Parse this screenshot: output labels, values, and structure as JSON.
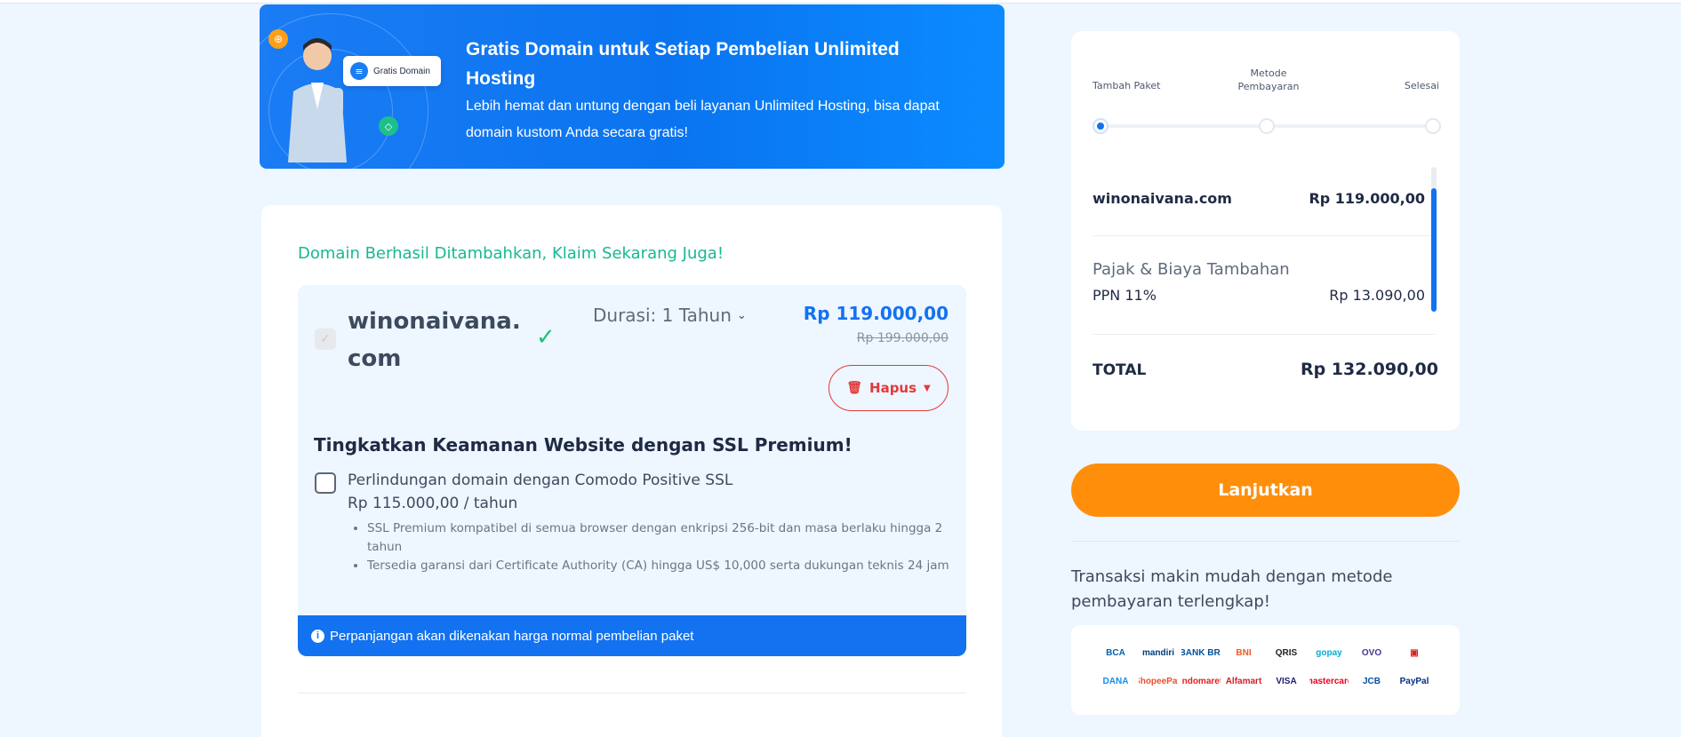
{
  "banner": {
    "badge_text": "Gratis Domain",
    "title": "Gratis Domain untuk Setiap Pembelian Unlimited Hosting",
    "subtitle": "Lebih hemat dan untung dengan beli layanan Unlimited Hosting, bisa dapat domain kustom Anda secara gratis!"
  },
  "main": {
    "success_message": "Domain Berhasil Ditambahkan, Klaim Sekarang Juga!",
    "domain": {
      "name": "winonaivana.com",
      "duration": "Durasi: 1 Tahun",
      "price": "Rp 119.000,00",
      "old_price": "Rp 199.000,00",
      "remove_label": "Hapus"
    },
    "ssl": {
      "title": "Tingkatkan Keamanan Website dengan SSL Premium!",
      "option_label": "Perlindungan domain dengan Comodo Positive SSL",
      "option_price": "Rp 115.000,00 / tahun",
      "features": [
        "SSL Premium kompatibel di semua browser dengan enkripsi 256-bit dan masa berlaku hingga 2 tahun",
        "Tersedia garansi dari Certificate Authority (CA) hingga US$ 10,000 serta dukungan teknis 24 jam"
      ]
    },
    "renewal_notice": "Perpanjangan akan dikenakan harga normal pembelian paket"
  },
  "summary": {
    "steps": [
      "Tambah Paket",
      "Metode Pembayaran",
      "Selesai"
    ],
    "active_step": 1,
    "items": [
      {
        "name": "winonaivana.com",
        "price": "Rp 119.000,00"
      }
    ],
    "tax_title": "Pajak & Biaya Tambahan",
    "tax_items": [
      {
        "name": "PPN 11%",
        "price": "Rp 13.090,00"
      }
    ],
    "total_label": "TOTAL",
    "total_value": "Rp 132.090,00"
  },
  "continue_label": "Lanjutkan",
  "payment": {
    "text": "Transaksi makin mudah dengan metode pembayaran terlengkap!",
    "logos": [
      {
        "label": "BCA",
        "color": "#0060af"
      },
      {
        "label": "mandiri",
        "color": "#003d79"
      },
      {
        "label": "BANK BRI",
        "color": "#00529c"
      },
      {
        "label": "BNI",
        "color": "#f15a23"
      },
      {
        "label": "QRIS",
        "color": "#222222"
      },
      {
        "label": "gopay",
        "color": "#00aed6"
      },
      {
        "label": "OVO",
        "color": "#4c3494"
      },
      {
        "label": "▣",
        "color": "#e02020"
      },
      {
        "label": "DANA",
        "color": "#118eea"
      },
      {
        "label": "ShopeePay",
        "color": "#ee4d2d"
      },
      {
        "label": "Indomaret",
        "color": "#e02020"
      },
      {
        "label": "Alfamart",
        "color": "#d21f26"
      },
      {
        "label": "VISA",
        "color": "#1a1f71"
      },
      {
        "label": "mastercard",
        "color": "#eb001b"
      },
      {
        "label": "JCB",
        "color": "#0b4ea2"
      },
      {
        "label": "PayPal",
        "color": "#003087"
      }
    ]
  },
  "colors": {
    "primary": "#1272f0",
    "accent_orange": "#ff8f0a",
    "success_green": "#17b890",
    "danger_red": "#e23a3a"
  }
}
